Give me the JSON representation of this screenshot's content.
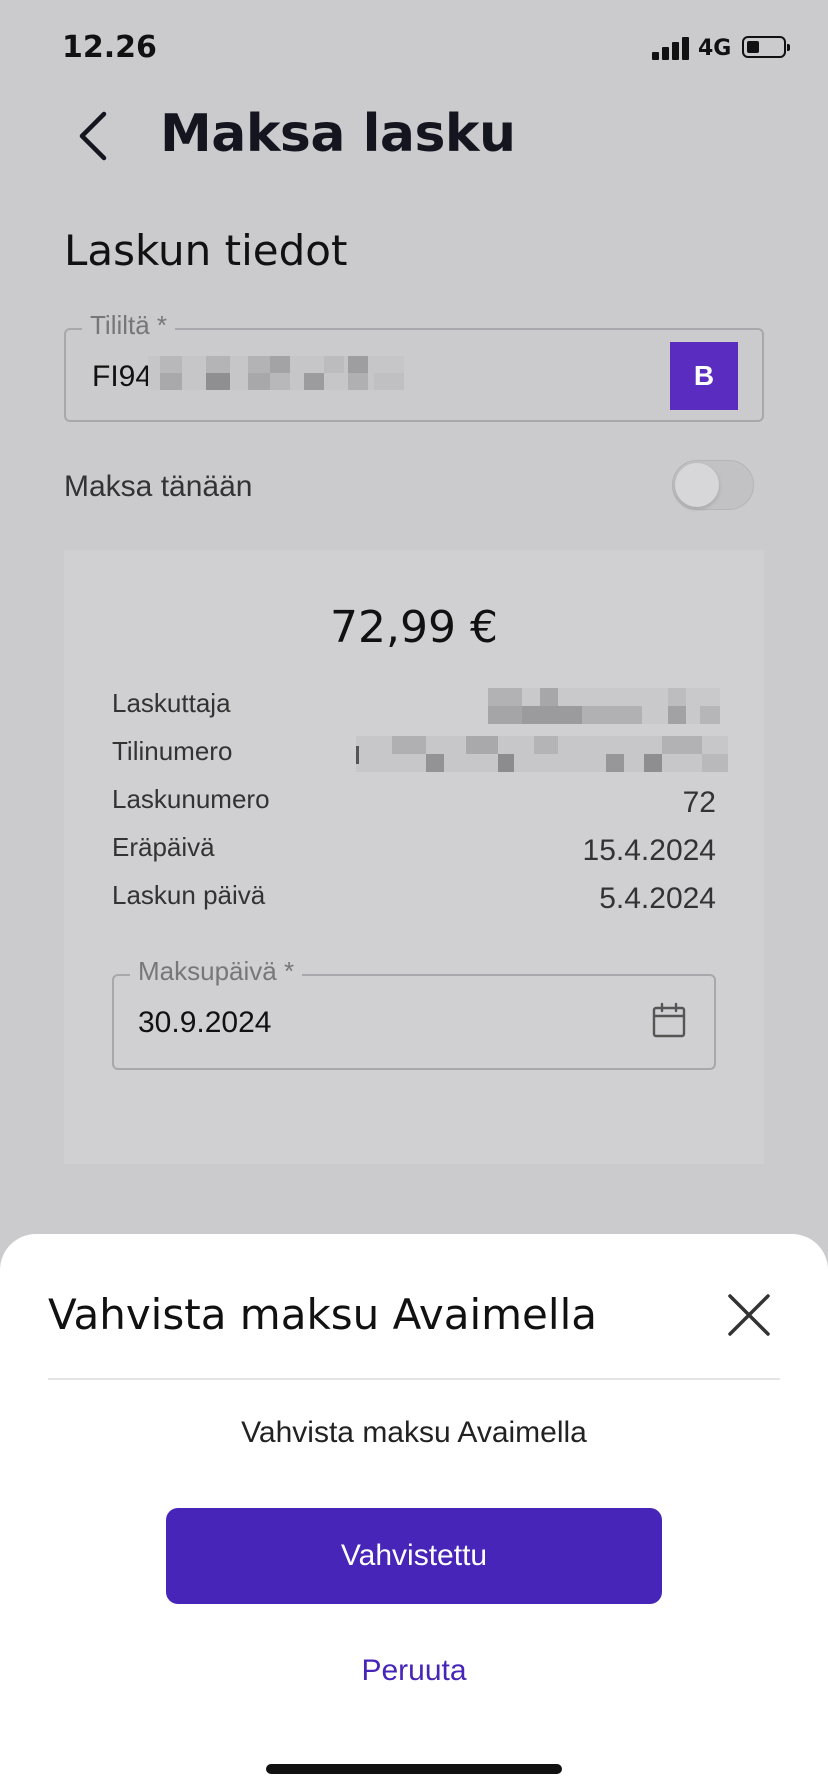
{
  "status_bar": {
    "time": "12.26",
    "network": "4G",
    "battery_level": 0.25
  },
  "header": {
    "title": "Maksa lasku",
    "back_icon": "chevron-left-icon"
  },
  "section": {
    "title": "Laskun tiedot"
  },
  "from_account": {
    "label": "Tililtä *",
    "value_prefix": "FI94",
    "bank_logo_text": "B"
  },
  "pay_today": {
    "label": "Maksa tänään",
    "enabled": false
  },
  "invoice": {
    "amount": "72,99 €",
    "rows": [
      {
        "label": "Laskuttaja",
        "value": ""
      },
      {
        "label": "Tilinumero",
        "value": ""
      },
      {
        "label": "Laskunumero",
        "value": "72"
      },
      {
        "label": "Eräpäivä",
        "value": "15.4.2024"
      },
      {
        "label": "Laskun päivä",
        "value": "5.4.2024"
      }
    ],
    "payment_date": {
      "label": "Maksupäivä *",
      "value": "30.9.2024",
      "icon": "calendar-icon"
    }
  },
  "sheet": {
    "title": "Vahvista maksu Avaimella",
    "message": "Vahvista maksu Avaimella",
    "confirm_label": "Vahvistettu",
    "cancel_label": "Peruuta",
    "close_icon": "close-icon"
  },
  "colors": {
    "accent": "#4625b8",
    "overlay": "#cbcbcd",
    "bank_logo": "#5a2cc0"
  }
}
